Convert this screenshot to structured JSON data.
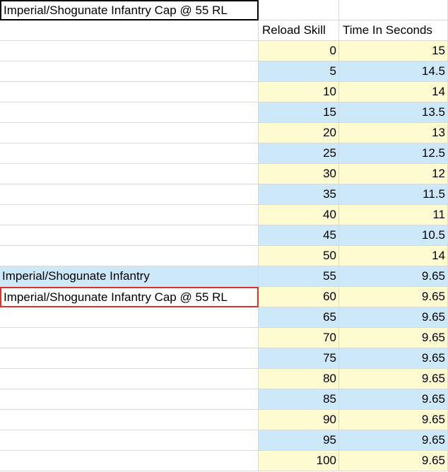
{
  "title_cell": "Imperial/Shogunate Infantry Cap @ 55 RL",
  "headers": {
    "reload_skill": "Reload Skill",
    "time_in_seconds": "Time In Seconds"
  },
  "rows": [
    {
      "label": "",
      "skill": "0",
      "time": "15"
    },
    {
      "label": "",
      "skill": "5",
      "time": "14.5"
    },
    {
      "label": "",
      "skill": "10",
      "time": "14"
    },
    {
      "label": "",
      "skill": "15",
      "time": "13.5"
    },
    {
      "label": "",
      "skill": "20",
      "time": "13"
    },
    {
      "label": "",
      "skill": "25",
      "time": "12.5"
    },
    {
      "label": "",
      "skill": "30",
      "time": "12"
    },
    {
      "label": "",
      "skill": "35",
      "time": "11.5"
    },
    {
      "label": "",
      "skill": "40",
      "time": "11"
    },
    {
      "label": "",
      "skill": "45",
      "time": "10.5"
    },
    {
      "label": "",
      "skill": "50",
      "time": "14"
    },
    {
      "label": "Imperial/Shogunate Infantry",
      "skill": "55",
      "time": "9.65"
    },
    {
      "label": "Imperial/Shogunate Infantry Cap @ 55 RL",
      "skill": "60",
      "time": "9.65"
    },
    {
      "label": "",
      "skill": "65",
      "time": "9.65"
    },
    {
      "label": "",
      "skill": "70",
      "time": "9.65"
    },
    {
      "label": "",
      "skill": "75",
      "time": "9.65"
    },
    {
      "label": "",
      "skill": "80",
      "time": "9.65"
    },
    {
      "label": "",
      "skill": "85",
      "time": "9.65"
    },
    {
      "label": "",
      "skill": "90",
      "time": "9.65"
    },
    {
      "label": "",
      "skill": "95",
      "time": "9.65"
    },
    {
      "label": "",
      "skill": "100",
      "time": "9.65"
    }
  ],
  "colors": {
    "yellow_fill": "#fffbd0",
    "blue_fill": "#cde9f9",
    "selection_border": "#e03030"
  }
}
